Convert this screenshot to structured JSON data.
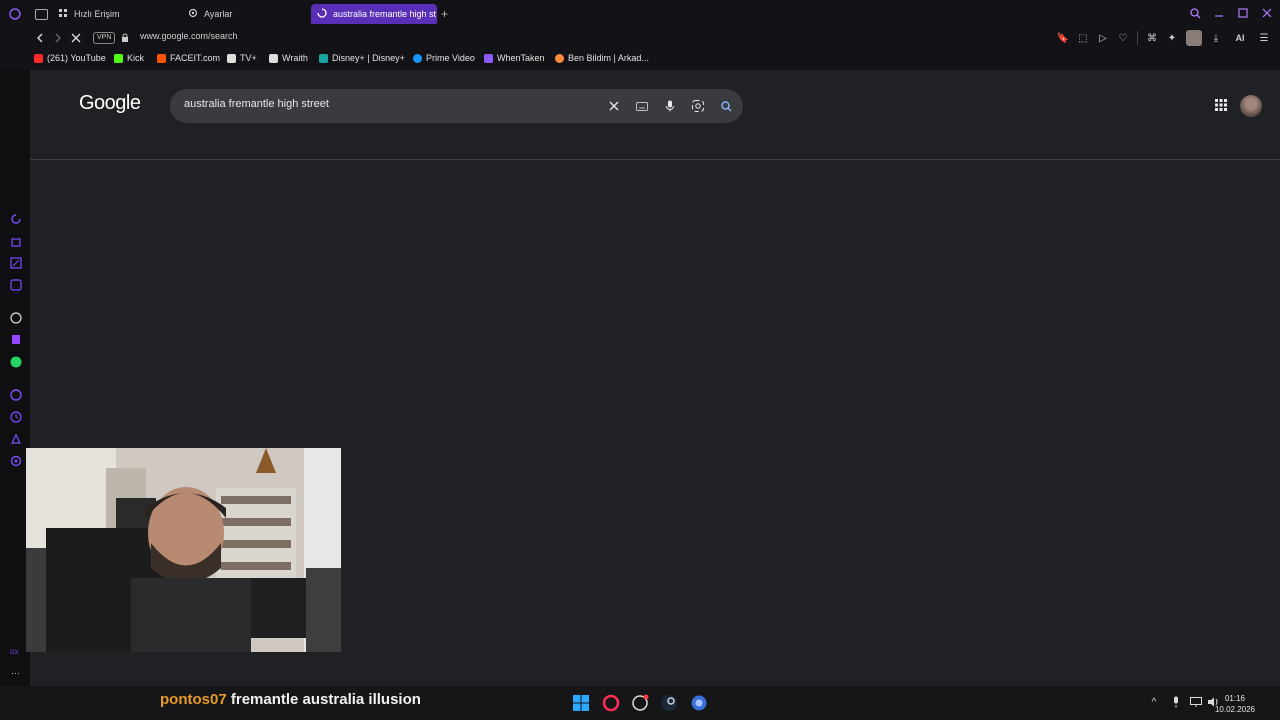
{
  "browser": {
    "tabs": [
      {
        "label": "Hızlı Erişim",
        "icon": "grid-icon"
      },
      {
        "label": "Ayarlar",
        "icon": "gear-icon"
      },
      {
        "label": "australia fremantle high st",
        "icon": "loading-icon",
        "active": true
      }
    ],
    "new_tab_label": "+",
    "address": {
      "vpn": "VPN",
      "url": "www.google.com/search"
    },
    "toolbar_ai_label": "AI",
    "bookmarks": [
      {
        "label": "(261) YouTube",
        "color": "#ff2a2a"
      },
      {
        "label": "Kick",
        "color": "#53fc18"
      },
      {
        "label": "FACEIT.com",
        "color": "#ff5500"
      },
      {
        "label": "TV+",
        "color": "#dddddd"
      },
      {
        "label": "Wraith",
        "color": "#dddddd"
      },
      {
        "label": "Disney+ | Disney+",
        "color": "#1aa3a3"
      },
      {
        "label": "Prime Video",
        "color": "#1a98ff"
      },
      {
        "label": "WhenTaken",
        "color": "#8a5cff"
      },
      {
        "label": "Ben Bildim | Arkad...",
        "color": "#ff8a3d"
      }
    ],
    "sidebar_labels": {
      "gx": "GX",
      "more": "···"
    }
  },
  "google": {
    "logo": "Google",
    "query": "australia fremantle high street"
  },
  "taskbar": {
    "chat_user": "pontos07",
    "chat_message": "fremantle australia illusion",
    "time": "01:16",
    "date": "10.02.2026"
  }
}
